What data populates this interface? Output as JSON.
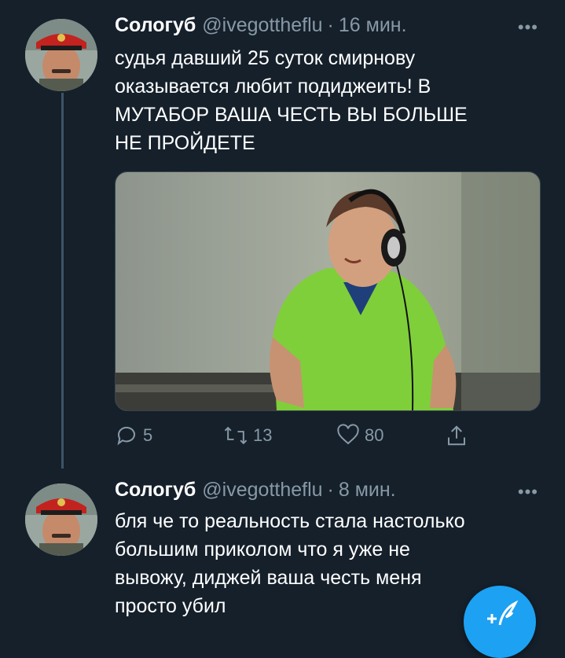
{
  "tweets": [
    {
      "name": "Сологуб",
      "handle": "@ivegottheflu",
      "time": "16 мин.",
      "text": "судья давший 25 суток смирнову\nоказывается любит подиджеить! В\nМУТАБОР ВАША ЧЕСТЬ ВЫ БОЛЬШЕ\nНЕ ПРОЙДЕТЕ",
      "replies": "5",
      "retweets": "13",
      "likes": "80"
    },
    {
      "name": "Сологуб",
      "handle": "@ivegottheflu",
      "time": "8 мин.",
      "text": "бля че то реальность стала настолько\nбольшим приколом что я уже не\nвывожу, диджей ваша честь меня\nпросто убил"
    }
  ],
  "dot_separator": "·",
  "more_label": "•••",
  "colors": {
    "background": "#15202b",
    "text": "#ffffff",
    "secondary": "#8899a6",
    "accent": "#1da1f2",
    "thread_line": "#3d5466"
  },
  "icons": {
    "reply": "reply-icon",
    "retweet": "retweet-icon",
    "like": "heart-icon",
    "share": "share-icon",
    "compose": "compose-tweet-icon",
    "more": "more-icon"
  }
}
